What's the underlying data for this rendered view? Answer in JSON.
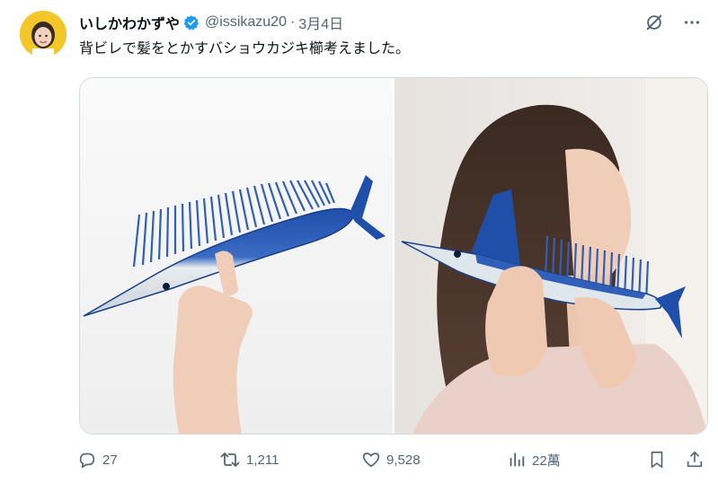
{
  "tweet": {
    "author_name": "いしかわかずや",
    "handle": "@issikazu20",
    "separator": "·",
    "date": "3月4日",
    "text": "背ビレで髪をとかすバショウカジキ櫛考えました。"
  },
  "icons": {
    "verified": "verified-badge-icon",
    "grok": "grok-icon",
    "more": "more-icon",
    "reply": "reply-icon",
    "retweet": "retweet-icon",
    "like": "heart-icon",
    "views": "views-chart-icon",
    "bookmark": "bookmark-icon",
    "share": "share-icon"
  },
  "stats": {
    "replies": "27",
    "retweets": "1,211",
    "likes": "9,528",
    "views": "22萬"
  },
  "colors": {
    "verified": "#1d9bf0",
    "avatar_bg": "#f3c72a",
    "secondary_text": "#536471",
    "fish_blue": "#1f4fa8"
  }
}
